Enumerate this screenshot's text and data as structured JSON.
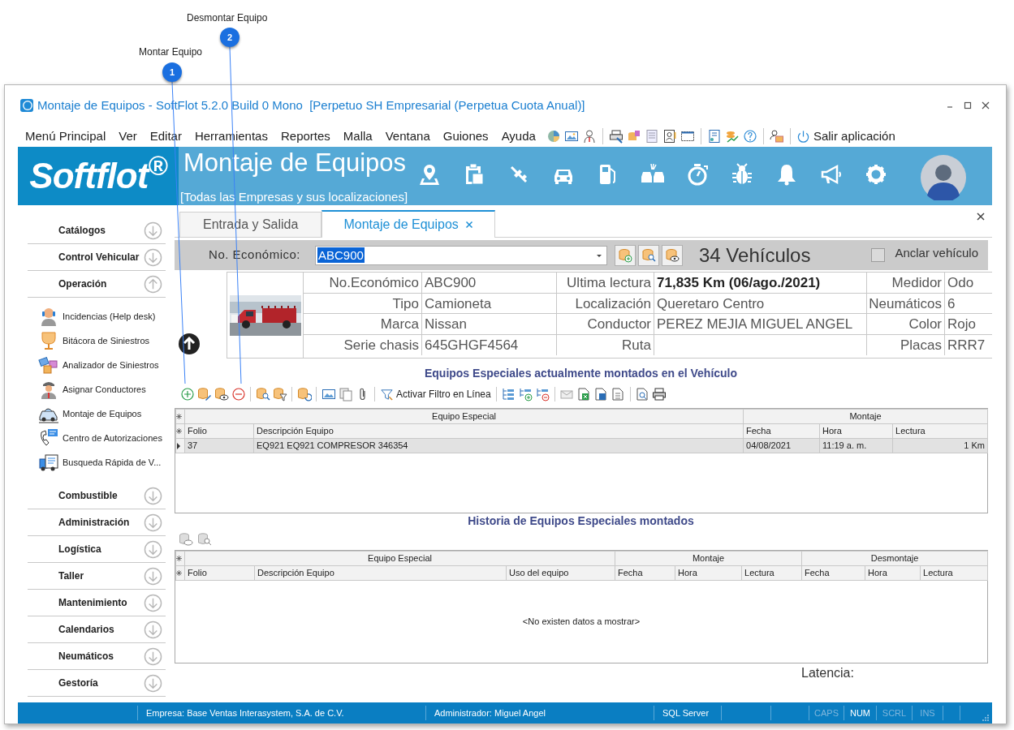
{
  "callouts": [
    {
      "number": "1",
      "label": "Montar Equipo"
    },
    {
      "number": "2",
      "label": "Desmontar Equipo"
    }
  ],
  "window": {
    "title": "Montaje de Equipos - SoftFlot 5.2.0 Build 0 Mono  [Perpetuo SH Empresarial (Perpetua Cuota Anual)]"
  },
  "menu": [
    "Menú Principal",
    "Ver",
    "Editar",
    "Herramientas",
    "Reportes",
    "Malla",
    "Ventana",
    "Guiones",
    "Ayuda"
  ],
  "exit_button": "Salir aplicación",
  "logo": "Softflot$^{®}$",
  "banner": {
    "title": "Montaje de Equipos",
    "subtitle": "[Todas las Empresas y sus localizaciones]"
  },
  "sidebar": {
    "groups": [
      {
        "label": "Catálogos",
        "expanded": false
      },
      {
        "label": "Control Vehicular",
        "expanded": false
      },
      {
        "label": "Operación",
        "expanded": true,
        "items": [
          "Incidencias (Help desk)",
          "Bitácora de Siniestros",
          "Analizador de Siniestros",
          "Asignar Conductores",
          "Montaje de Equipos",
          "Centro de Autorizaciones",
          "Busqueda Rápida de V..."
        ]
      },
      {
        "label": "Combustible",
        "expanded": false
      },
      {
        "label": "Administración",
        "expanded": false
      },
      {
        "label": "Logística",
        "expanded": false
      },
      {
        "label": "Taller",
        "expanded": false
      },
      {
        "label": "Mantenimiento",
        "expanded": false
      },
      {
        "label": "Calendarios",
        "expanded": false
      },
      {
        "label": "Neumáticos",
        "expanded": false
      },
      {
        "label": "Gestoría",
        "expanded": false
      }
    ]
  },
  "tabs": [
    {
      "label": "Entrada y Salida",
      "selected": false
    },
    {
      "label": "Montaje de Equipos",
      "selected": true
    }
  ],
  "vehicle_bar": {
    "label": "No. Económico:",
    "value": "ABC900",
    "count": "34 Vehículos",
    "pin_label": "Anclar vehículo",
    "pinned": false
  },
  "vehicle_info": {
    "photo": {
      "kind": "picture"
    },
    "rows": [
      [
        {
          "label": "No.Económico",
          "value": "ABC900",
          "strong": false
        },
        {
          "label": "Ultima lectura",
          "value": "71,835 Km  (06/ago./2021)",
          "strong": true
        },
        {
          "label": "Medidor",
          "value": "Odo",
          "strong": false
        }
      ],
      [
        {
          "label": "Tipo",
          "value": "Camioneta",
          "strong": false
        },
        {
          "label": "Localización",
          "value": "Queretaro Centro",
          "strong": false
        },
        {
          "label": "Neumáticos",
          "value": "6",
          "strong": false
        }
      ],
      [
        {
          "label": "Marca",
          "value": "Nissan",
          "strong": false
        },
        {
          "label": "Conductor",
          "value": "PEREZ MEJIA MIGUEL ANGEL",
          "strong": false
        },
        {
          "label": "Color",
          "value": "Rojo",
          "strong": false
        }
      ],
      [
        {
          "label": "Serie chasis",
          "value": "645GHGF4564",
          "strong": false
        },
        {
          "label": "Ruta"
        },
        {
          "label": "Placas",
          "value": "RRR7",
          "strong": false
        }
      ]
    ]
  },
  "current_equipment": {
    "title": "Equipos Especiales actualmente montados en el Vehículo",
    "filter_button": "Activar Filtro en Línea",
    "table": {
      "column_groups": [
        "Equipo Especial",
        "Montaje"
      ],
      "columns": [
        "Folio",
        "Descripción Equipo",
        "Fecha",
        "Hora",
        "Lectura"
      ],
      "rows": [
        {
          "selected": true,
          "cells": [
            "37",
            "EQ921 EQ921 COMPRESOR 346354",
            "04/08/2021",
            "11:19 a. m.",
            "1 Km"
          ]
        }
      ]
    }
  },
  "history": {
    "title": "Historia de Equipos Especiales montados",
    "table": {
      "column_groups": [
        "Equipo Especial",
        "Montaje",
        "Desmontaje"
      ],
      "columns": [
        "Folio",
        "Descripción Equipo",
        "Uso del equipo",
        "Fecha",
        "Hora",
        "Lectura",
        "Fecha",
        "Hora",
        "Lectura"
      ],
      "empty_text": "<No existen datos a mostrar>"
    }
  },
  "latency": {
    "label": "Latencia:"
  },
  "status_bar": {
    "company": "Empresa: Base Ventas Interasystem, S.A. de C.V.",
    "user": "Administrador: Miguel Angel",
    "database": "SQL Server",
    "indicators": [
      {
        "label": "CAPS",
        "on": false
      },
      {
        "label": "NUM",
        "on": true
      },
      {
        "label": "SCRL",
        "on": false
      },
      {
        "label": "INS",
        "on": false
      }
    ]
  }
}
